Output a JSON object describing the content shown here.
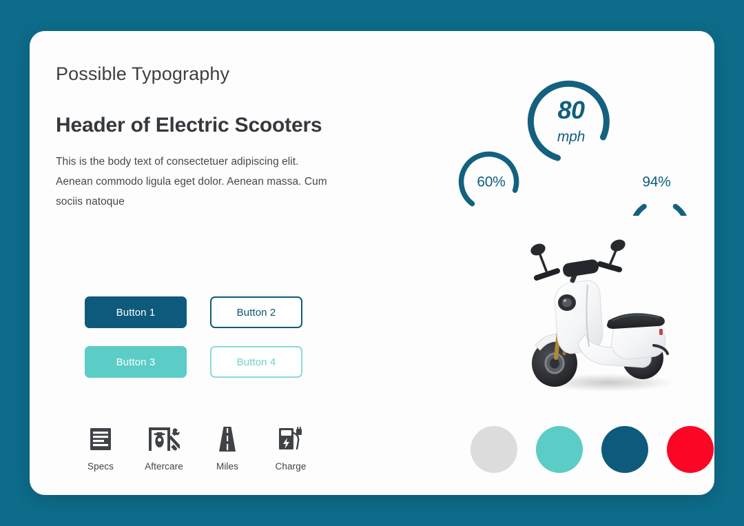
{
  "background": {
    "color": "#0d6c8a"
  },
  "card": {
    "background": "#fdfdfd"
  },
  "typography": {
    "eyebrow": "Possible Typography",
    "headline": "Header of Electric Scooters",
    "body": "This is the body text of  consectetuer adipiscing elit. Aenean commodo ligula eget dolor. Aenean massa. Cum sociis natoque"
  },
  "buttons": [
    {
      "label": "Button 1",
      "style": "primary",
      "fill": "#0e5a7d",
      "text_color": "#ffffff"
    },
    {
      "label": "Button 2",
      "style": "outline",
      "fill": "#ffffff",
      "text_color": "#11506e"
    },
    {
      "label": "Button 3",
      "style": "secondary",
      "fill": "#5cccc6",
      "text_color": "#ffffff"
    },
    {
      "label": "Button 4",
      "style": "ghost",
      "fill": "#ffffff",
      "text_color": "#6fd2cb"
    }
  ],
  "features": [
    {
      "label": "Specs",
      "icon": "document-lines-icon"
    },
    {
      "label": "Aftercare",
      "icon": "scooter-garage-wrench-icon"
    },
    {
      "label": "Miles",
      "icon": "road-icon"
    },
    {
      "label": "Charge",
      "icon": "charging-station-icon"
    }
  ],
  "gauges": [
    {
      "name": "battery-gauge",
      "value": "60%",
      "percent": 60,
      "unit": "",
      "size": "small",
      "color": "#13617f"
    },
    {
      "name": "speed-gauge",
      "value": "80",
      "percent": 80,
      "unit": "mph",
      "size": "large",
      "color": "#13617f"
    },
    {
      "name": "capacity-gauge",
      "value": "94%",
      "percent": 94,
      "unit": "",
      "size": "small",
      "color": "#13617f"
    }
  ],
  "swatches": [
    {
      "name": "swatch-gray",
      "color": "#dcdcdc"
    },
    {
      "name": "swatch-teal",
      "color": "#5cccc6"
    },
    {
      "name": "swatch-dark-blue",
      "color": "#0e5a7d"
    },
    {
      "name": "swatch-red",
      "color": "#fb0625"
    }
  ],
  "product": {
    "alt": "white electric scooter"
  }
}
